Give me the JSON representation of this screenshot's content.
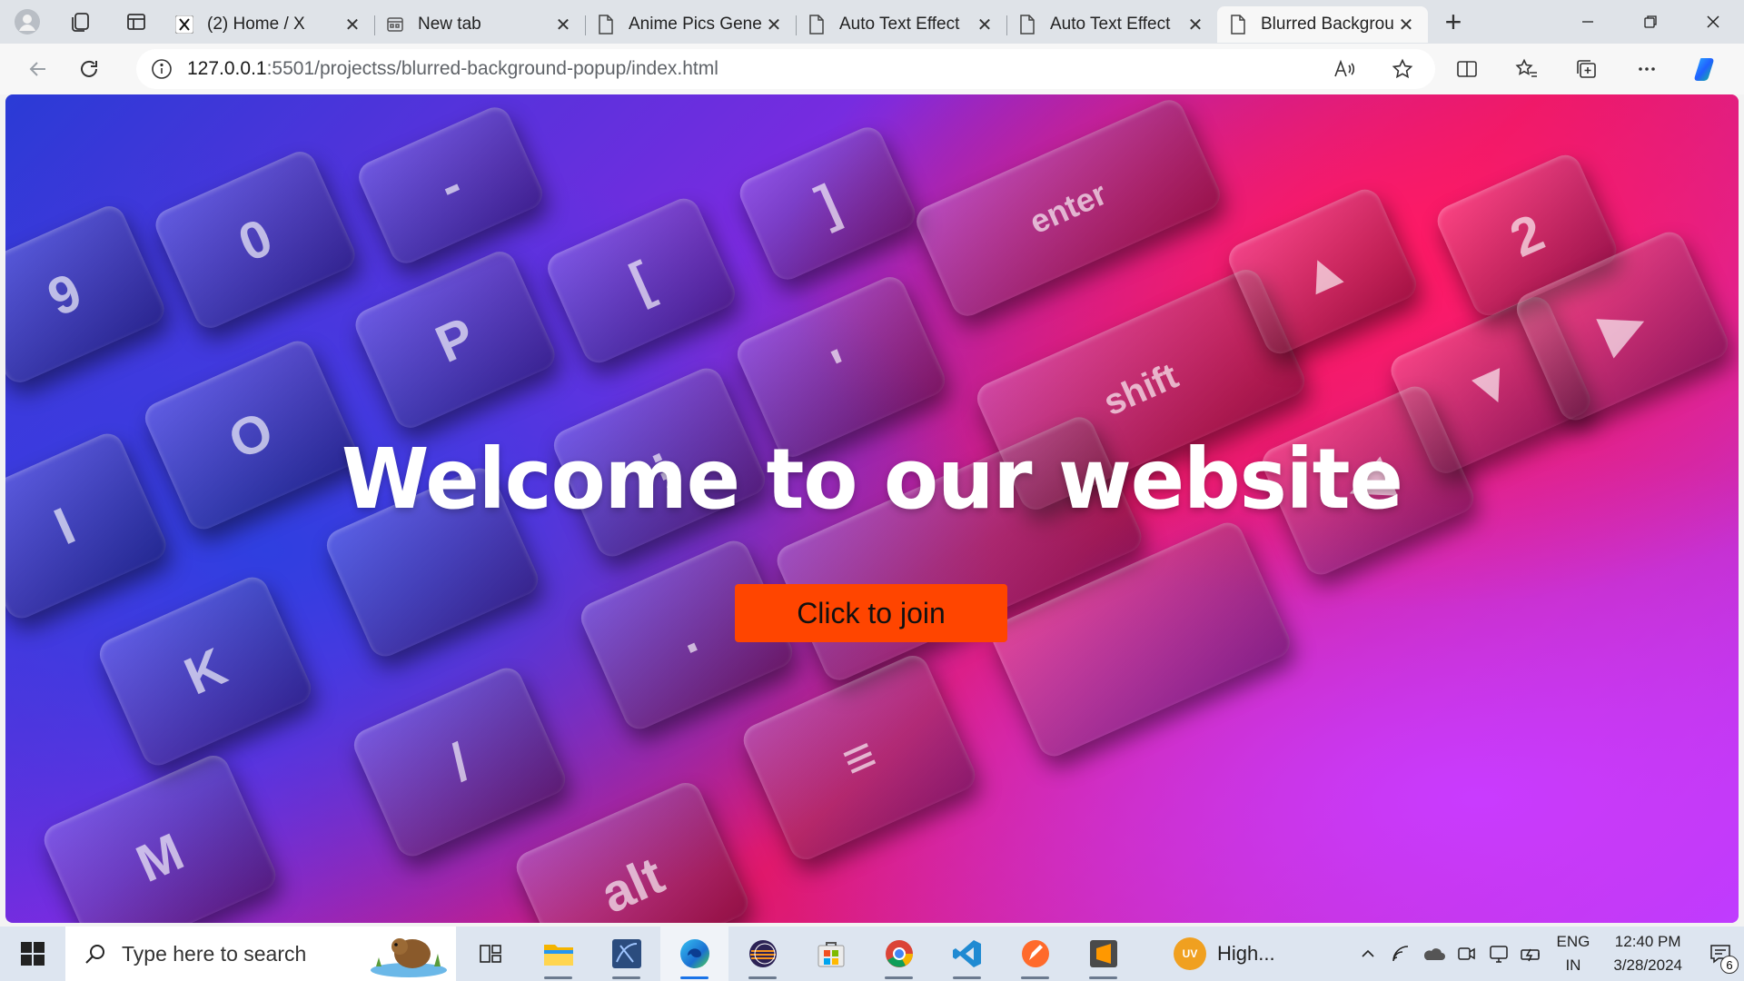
{
  "browser": {
    "tabs": [
      {
        "title": "(2) Home / X",
        "favicon": "x-logo-icon",
        "active": false
      },
      {
        "title": "New tab",
        "favicon": "new-tab-icon",
        "active": false
      },
      {
        "title": "Anime Pics Gene",
        "favicon": "page-icon",
        "active": false
      },
      {
        "title": "Auto Text Effect",
        "favicon": "page-icon",
        "active": false
      },
      {
        "title": "Auto Text Effect",
        "favicon": "page-icon",
        "active": false
      },
      {
        "title": "Blurred Backgrou",
        "favicon": "page-icon",
        "active": true
      }
    ],
    "address": {
      "host": "127.0.0.1",
      "path": ":5501/projectss/blurred-background-popup/index.html"
    }
  },
  "page": {
    "title": "Welcome to our website",
    "button_label": "Click to join",
    "button_color": "#ff4500"
  },
  "taskbar": {
    "search_placeholder": "Type here to search",
    "weather_badge": "UV",
    "weather_text": "High...",
    "language": "ENG",
    "region": "IN",
    "time": "12:40 PM",
    "date": "3/28/2024",
    "notification_count": "6"
  }
}
